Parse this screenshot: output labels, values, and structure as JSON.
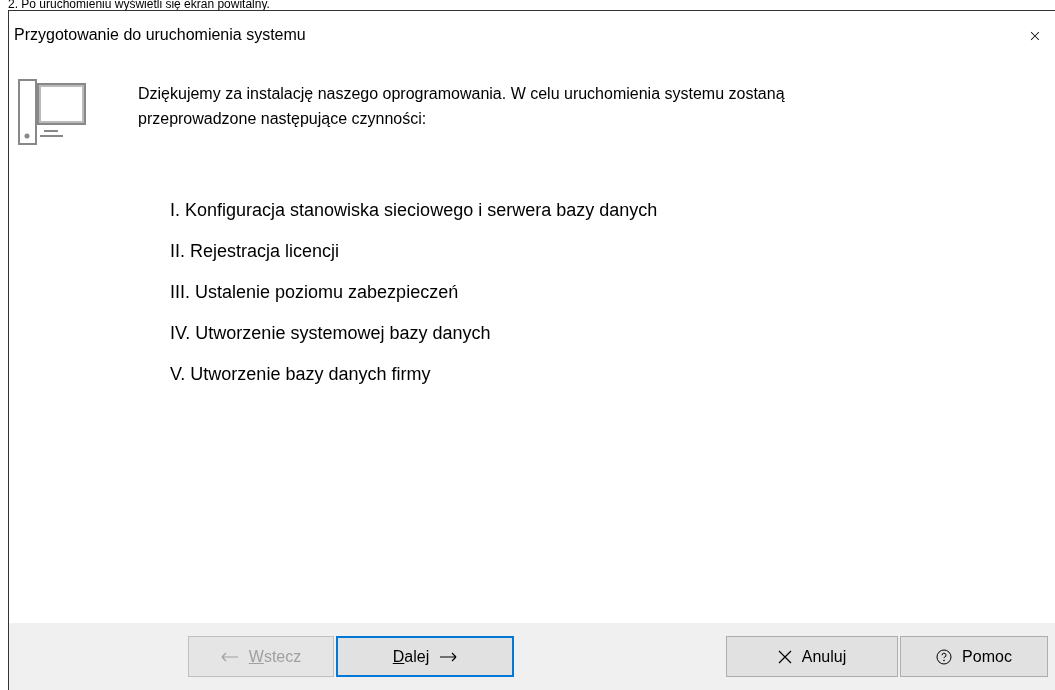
{
  "caption": "2. Po uruchomieniu wyświetli się ekran powitalny.",
  "window": {
    "title": "Przygotowanie do uruchomienia systemu",
    "close": "×"
  },
  "intro": "Dziękujemy za instalację naszego oprogramowania. W celu uruchomienia systemu zostaną przeprowadzone następujące czynności:",
  "steps": [
    "I. Konfiguracja stanowiska sieciowego i serwera bazy danych",
    "II. Rejestracja licencji",
    "III. Ustalenie poziomu zabezpieczeń",
    "IV. Utworzenie systemowej bazy danych",
    "V. Utworzenie bazy danych firmy"
  ],
  "buttons": [
    {
      "kind": "back",
      "label": "Wstecz",
      "disabled": true,
      "focused": false,
      "underline_first": true
    },
    {
      "kind": "next",
      "label": "Dalej",
      "disabled": false,
      "focused": true,
      "underline_first": true
    },
    {
      "kind": "cancel",
      "label": "Anuluj",
      "disabled": false,
      "focused": false,
      "underline_first": false
    },
    {
      "kind": "help",
      "label": "Pomoc",
      "disabled": false,
      "focused": false,
      "underline_first": false
    }
  ]
}
